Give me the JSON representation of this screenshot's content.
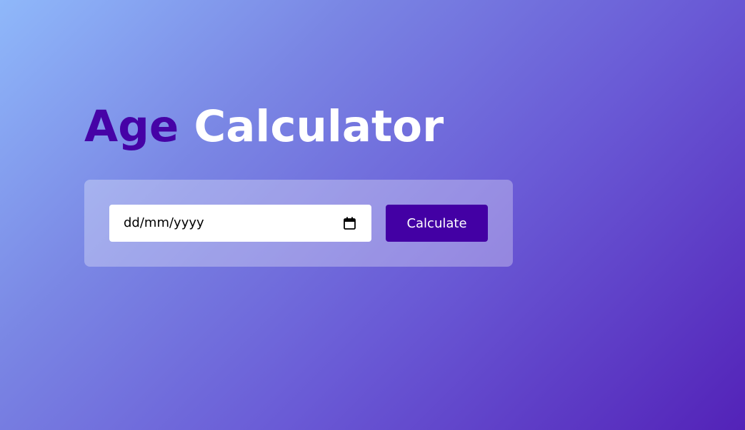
{
  "header": {
    "title_accent": "Age",
    "title_rest": "Calculator"
  },
  "form": {
    "date_placeholder": "dd/mm/yyyy",
    "date_value": "",
    "calendar_icon": "calendar-icon",
    "button_label": "Calculate"
  },
  "colors": {
    "accent": "#4603a6",
    "button": "#4300a4",
    "gradient_start": "#8fb8fa",
    "gradient_end": "#5322b8"
  }
}
